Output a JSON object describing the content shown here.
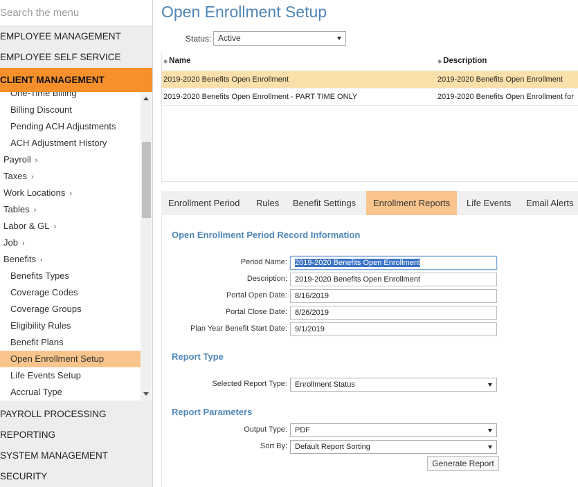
{
  "sidebar": {
    "search_placeholder": "Search the menu",
    "sections_top": [
      "EMPLOYEE MANAGEMENT",
      "EMPLOYEE SELF SERVICE"
    ],
    "active_section": "CLIENT MANAGEMENT",
    "submenu": [
      {
        "label": "One-Time Billing",
        "level": 2
      },
      {
        "label": "Billing Discount",
        "level": 2
      },
      {
        "label": "Pending ACH Adjustments",
        "level": 2
      },
      {
        "label": "ACH Adjustment History",
        "level": 2
      },
      {
        "label": "Payroll",
        "level": 1,
        "caret": "›"
      },
      {
        "label": "Taxes",
        "level": 1,
        "caret": "›"
      },
      {
        "label": "Work Locations",
        "level": 1,
        "caret": "›"
      },
      {
        "label": "Tables",
        "level": 1,
        "caret": "›"
      },
      {
        "label": "Labor & GL",
        "level": 1,
        "caret": "›"
      },
      {
        "label": "Job",
        "level": 1,
        "caret": "›"
      },
      {
        "label": "Benefits",
        "level": 1,
        "caret": "‹"
      },
      {
        "label": "Benefits Types",
        "level": 2
      },
      {
        "label": "Coverage Codes",
        "level": 2
      },
      {
        "label": "Coverage Groups",
        "level": 2
      },
      {
        "label": "Eligibility Rules",
        "level": 2
      },
      {
        "label": "Benefit Plans",
        "level": 2
      },
      {
        "label": "Open Enrollment Setup",
        "level": 2,
        "selected": true
      },
      {
        "label": "Life Events Setup",
        "level": 2
      },
      {
        "label": "Accrual Type",
        "level": 2
      }
    ],
    "sections_bottom": [
      "PAYROLL PROCESSING",
      "REPORTING",
      "SYSTEM MANAGEMENT",
      "SECURITY"
    ]
  },
  "page": {
    "title": "Open Enrollment Setup",
    "status_label": "Status:",
    "status_value": "Active"
  },
  "grid": {
    "columns": [
      "Name",
      "Description"
    ],
    "rows": [
      {
        "name": "2019-2020 Benefits Open Enrollment",
        "description": "2019-2020 Benefits Open Enrollment",
        "selected": true
      },
      {
        "name": "2019-2020 Benefits Open Enrollment - PART TIME ONLY",
        "description": "2019-2020 Benefits Open Enrollment for"
      }
    ]
  },
  "tabs": [
    "Enrollment Period",
    "Rules",
    "Benefit Settings",
    "Enrollment Reports",
    "Life Events",
    "Email Alerts"
  ],
  "active_tab": "Enrollment Reports",
  "form": {
    "section_record": "Open Enrollment Period Record Information",
    "fields": [
      {
        "label": "Period Name:",
        "value": "2019-2020 Benefits Open Enrollment"
      },
      {
        "label": "Description:",
        "value": "2019-2020 Benefits Open Enrollment"
      },
      {
        "label": "Portal Open Date:",
        "value": "8/16/2019"
      },
      {
        "label": "Portal Close Date:",
        "value": "8/26/2019"
      },
      {
        "label": "Plan Year Benefit Start Date:",
        "value": "9/1/2019"
      }
    ],
    "section_report_type": "Report Type",
    "report_type_label": "Selected Report Type:",
    "report_type_value": "Enrollment Status",
    "section_params": "Report Parameters",
    "output_type_label": "Output Type:",
    "output_type_value": "PDF",
    "sort_by_label": "Sort By:",
    "sort_by_value": "Default Report Sorting",
    "generate_label": "Generate Report"
  }
}
